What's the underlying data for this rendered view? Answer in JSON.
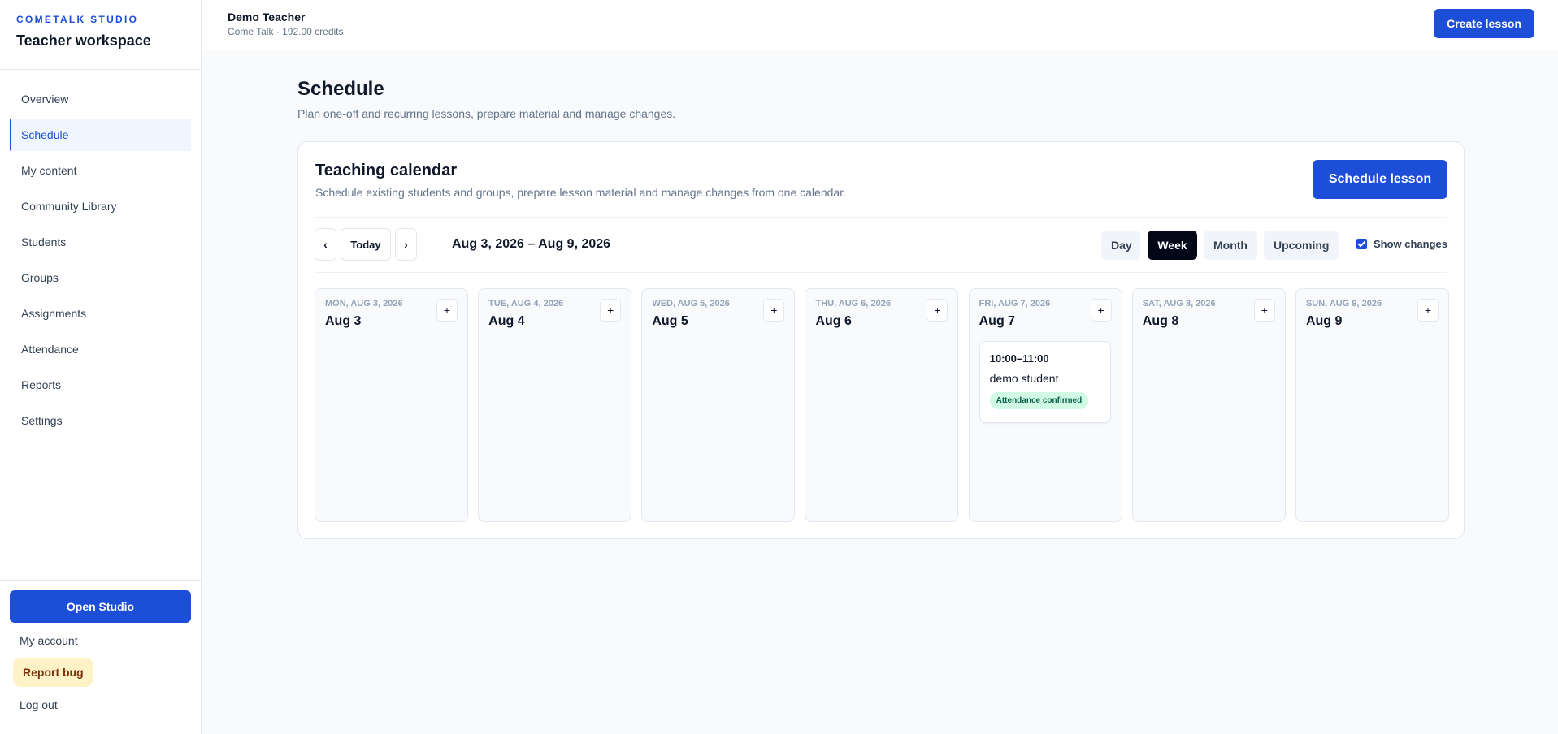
{
  "brand": {
    "name": "COMETALK STUDIO",
    "workspace": "Teacher workspace"
  },
  "sidebar": {
    "items": [
      {
        "label": "Overview",
        "active": false
      },
      {
        "label": "Schedule",
        "active": true
      },
      {
        "label": "My content",
        "active": false
      },
      {
        "label": "Community Library",
        "active": false
      },
      {
        "label": "Students",
        "active": false
      },
      {
        "label": "Groups",
        "active": false
      },
      {
        "label": "Assignments",
        "active": false
      },
      {
        "label": "Attendance",
        "active": false
      },
      {
        "label": "Reports",
        "active": false
      },
      {
        "label": "Settings",
        "active": false
      }
    ],
    "footer": {
      "open_studio": "Open Studio",
      "my_account": "My account",
      "report_bug": "Report bug",
      "log_out": "Log out"
    }
  },
  "header": {
    "user_name": "Demo Teacher",
    "user_meta": "Come Talk · 192.00 credits",
    "create_lesson": "Create lesson"
  },
  "page": {
    "title": "Schedule",
    "subtitle": "Plan one-off and recurring lessons, prepare material and manage changes."
  },
  "calendar": {
    "title": "Teaching calendar",
    "subtitle": "Schedule existing students and groups, prepare lesson material and manage changes from one calendar.",
    "schedule_button": "Schedule lesson",
    "prev": "‹",
    "today": "Today",
    "next": "›",
    "range": "Aug 3, 2026 – Aug 9, 2026",
    "views": [
      {
        "label": "Day",
        "active": false
      },
      {
        "label": "Week",
        "active": true
      },
      {
        "label": "Month",
        "active": false
      },
      {
        "label": "Upcoming",
        "active": false
      }
    ],
    "show_changes_label": "Show changes",
    "show_changes_checked": true,
    "add_label": "+",
    "days": [
      {
        "dow": "MON, AUG 3, 2026",
        "date": "Aug 3"
      },
      {
        "dow": "TUE, AUG 4, 2026",
        "date": "Aug 4"
      },
      {
        "dow": "WED, AUG 5, 2026",
        "date": "Aug 5"
      },
      {
        "dow": "THU, AUG 6, 2026",
        "date": "Aug 6"
      },
      {
        "dow": "FRI, AUG 7, 2026",
        "date": "Aug 7"
      },
      {
        "dow": "SAT, AUG 8, 2026",
        "date": "Aug 8"
      },
      {
        "dow": "SUN, AUG 9, 2026",
        "date": "Aug 9"
      }
    ],
    "event": {
      "time": "10:00–11:00",
      "student": "demo student",
      "badge": "Attendance confirmed"
    }
  },
  "colors": {
    "accent": "#1d4ed8",
    "active_view": "#020617",
    "badge_bg": "#d1fae5",
    "badge_text": "#065f46",
    "report_bug_bg": "#fef3c7"
  }
}
